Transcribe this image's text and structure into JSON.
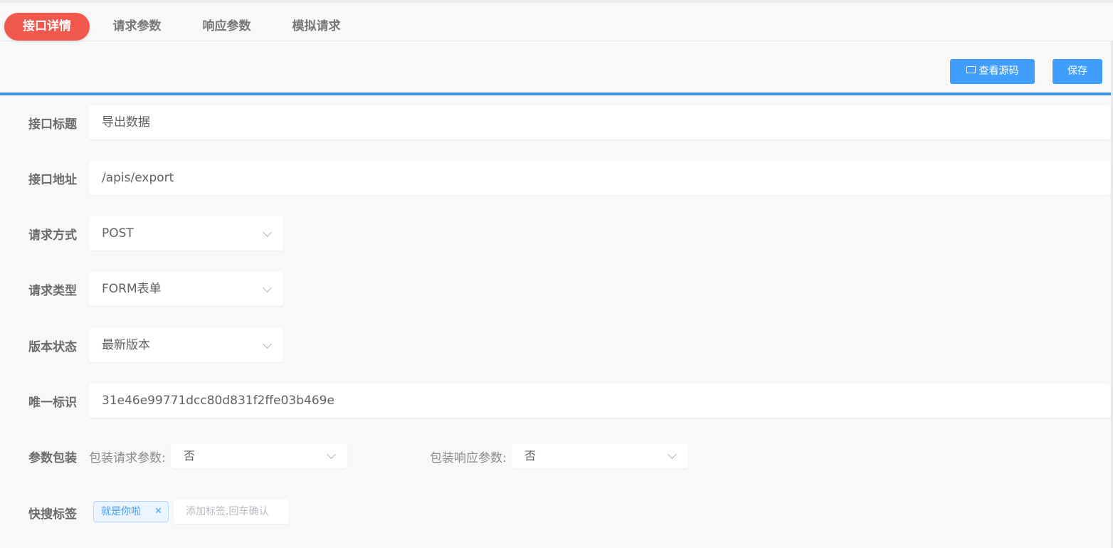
{
  "tabs": [
    {
      "label": "接口详情",
      "active": true
    },
    {
      "label": "请求参数",
      "active": false
    },
    {
      "label": "响应参数",
      "active": false
    },
    {
      "label": "模拟请求",
      "active": false
    }
  ],
  "toolbar": {
    "view_source_label": "查看源码",
    "view_source_icon": "folder-open-icon",
    "save_label": "保存"
  },
  "colors": {
    "active_tab": "#f0584b",
    "primary": "#409eff",
    "divider": "#4296e0"
  },
  "form": {
    "title": {
      "label": "接口标题",
      "value": "导出数据"
    },
    "url": {
      "label": "接口地址",
      "value": "/apis/export"
    },
    "method": {
      "label": "请求方式",
      "value": "POST"
    },
    "content_type": {
      "label": "请求类型",
      "value": "FORM表单"
    },
    "version_status": {
      "label": "版本状态",
      "value": "最新版本"
    },
    "unique_id": {
      "label": "唯一标识",
      "value": "31e46e99771dcc80d831f2ffe03b469e"
    },
    "wrap": {
      "label": "参数包装",
      "request_label": "包装请求参数:",
      "request_value": "否",
      "response_label": "包装响应参数:",
      "response_value": "否"
    },
    "tags": {
      "label": "快搜标签",
      "items": [
        "就是你啦"
      ],
      "input_placeholder": "添加标签,回车确认"
    }
  }
}
